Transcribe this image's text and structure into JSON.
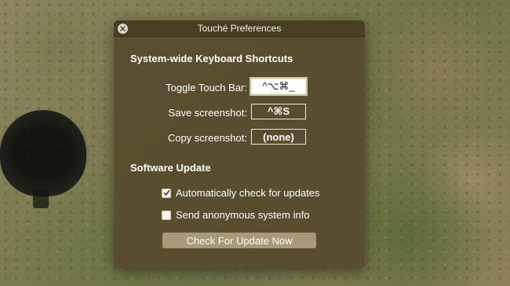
{
  "window": {
    "title": "Touché Preferences"
  },
  "keyboard_section": {
    "heading": "System-wide Keyboard Shortcuts",
    "rows": [
      {
        "label": "Toggle Touch Bar:",
        "shortcut": "^⌥⌘_",
        "state": "editing"
      },
      {
        "label": "Save screenshot:",
        "shortcut": "^⌘S",
        "state": "set"
      },
      {
        "label": "Copy screenshot:",
        "shortcut": "(none)",
        "state": "set"
      }
    ]
  },
  "update_section": {
    "heading": "Software Update",
    "options": [
      {
        "label": "Automatically check for updates",
        "checked": true
      },
      {
        "label": "Send anonymous system info",
        "checked": false
      }
    ],
    "button_label": "Check For Update Now"
  },
  "icons": {
    "close": "close-icon",
    "check": "checkmark-icon"
  },
  "colors": {
    "window_bg": "#564a2c",
    "titlebar_bg": "#483e24",
    "button_bg": "#a69a79",
    "text": "#ffffff"
  }
}
